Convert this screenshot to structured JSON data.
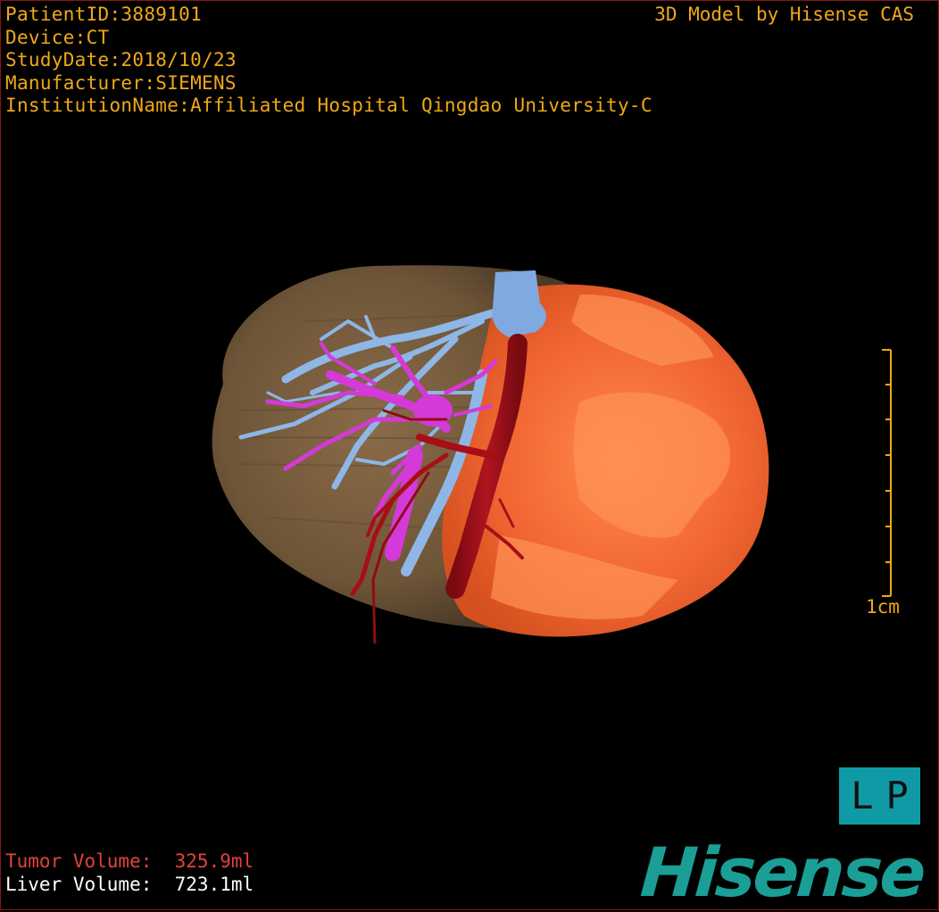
{
  "header": {
    "patient_id": "PatientID:3889101",
    "device": "Device:CT",
    "study_date": "StudyDate:2018/10/23",
    "manufacturer": "Manufacturer:SIEMENS",
    "institution": "InstitutionName:Affiliated Hospital Qingdao University-C"
  },
  "credit": "3D Model by Hisense CAS",
  "scale": {
    "label": "1cm"
  },
  "orientation": {
    "left": "L",
    "right": "P"
  },
  "volumes": {
    "tumor": "Tumor Volume:  325.9ml",
    "liver": "Liver Volume:  723.1ml"
  },
  "logo": "Hisense",
  "colors": {
    "text": "#f0a818",
    "tumor_text": "#e0443a",
    "liver_text": "#ffffff",
    "liver": "#7d6243",
    "tumor": "#f26a38",
    "portal_vein": "#d43ad8",
    "hepatic_vein": "#8eb6e6",
    "artery": "#a80e16",
    "logo": "#1a9e96",
    "orient_box": "#0f9aa6"
  }
}
